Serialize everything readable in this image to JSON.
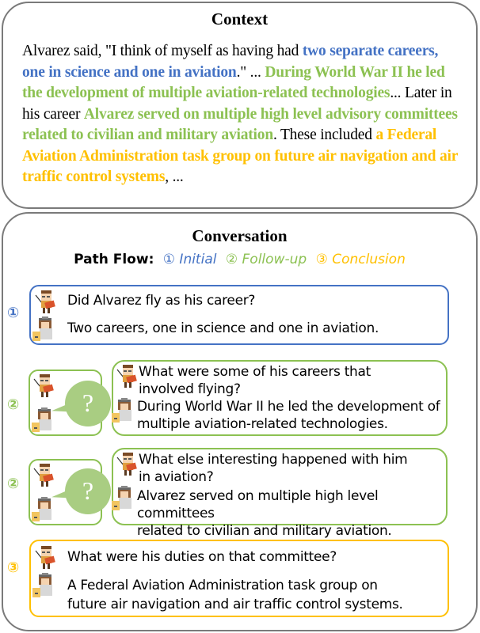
{
  "context": {
    "title": "Context",
    "segments": [
      {
        "text": "Alvarez said, \"I think of myself as having had ",
        "style": "plain"
      },
      {
        "text": "two separate careers, one in science and one in aviation",
        "style": "blue"
      },
      {
        "text": ".\" ... ",
        "style": "plain"
      },
      {
        "text": "During World War II he led the development of multiple aviation-related technologies",
        "style": "green"
      },
      {
        "text": "... Later in his career ",
        "style": "plain"
      },
      {
        "text": "Alvarez served on multiple high level advisory committees related to civilian and military aviation",
        "style": "green"
      },
      {
        "text": ". These included ",
        "style": "plain"
      },
      {
        "text": "a Federal Aviation Administration task group on future air navigation and air traffic control systems",
        "style": "yellow"
      },
      {
        "text": ", ...",
        "style": "plain"
      }
    ]
  },
  "conversation": {
    "title": "Conversation",
    "path_flow": {
      "label": "Path Flow:",
      "items": [
        {
          "text": "① Initial",
          "color": "#4472c4"
        },
        {
          "text": "② Follow-up",
          "color": "#8cc152"
        },
        {
          "text": "③ Conclusion",
          "color": "#ffc000"
        }
      ]
    },
    "turns": [
      {
        "step": "①",
        "type": "initial",
        "question": "Did Alvarez fly as his career?",
        "answer": "Two careers, one in science and one in aviation."
      },
      {
        "step": "②",
        "type": "follow-up",
        "bubble_symbol": "?",
        "question_lines": [
          "What were some of his careers that",
          "involved flying?"
        ],
        "answer_lines": [
          "During World War II he led the development of",
          "multiple aviation-related technologies."
        ]
      },
      {
        "step": "②",
        "type": "follow-up",
        "bubble_symbol": "?",
        "question_lines": [
          "What else interesting happened with him",
          "in aviation?"
        ],
        "answer_lines": [
          "Alvarez served on multiple high level committees",
          "related to civilian and military aviation."
        ]
      },
      {
        "step": "③",
        "type": "conclusion",
        "question": "What were his duties on that committee?",
        "answer_lines": [
          "A Federal Aviation Administration task group on",
          "future air navigation and air traffic control systems."
        ]
      }
    ]
  },
  "colors": {
    "initial": "#4472c4",
    "follow_up": "#8cc152",
    "conclusion": "#ffc000",
    "bubble": "#a9cd82",
    "panel_border": "#7a7a7a"
  },
  "icons": {
    "questioner": "teacher-avatar-icon",
    "answerer": "student-avatar-icon",
    "thinking": "question-bubble-icon"
  }
}
